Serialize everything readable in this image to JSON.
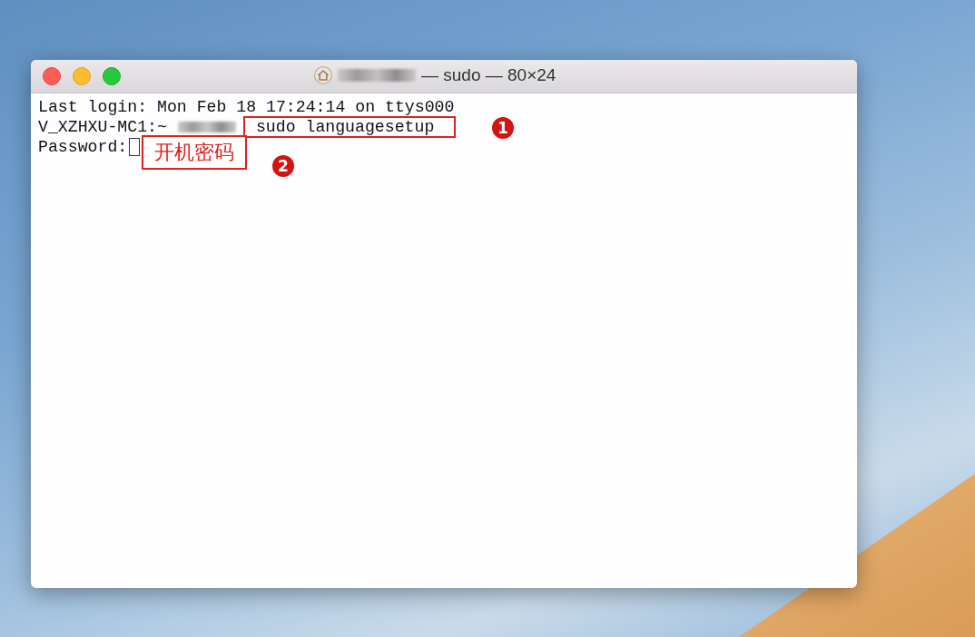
{
  "window": {
    "title": "— sudo — 80×24"
  },
  "terminal": {
    "lines": [
      {
        "kind": "output",
        "text": "Last login: Mon Feb 18 17:24:14 on ttys000"
      },
      {
        "kind": "command",
        "prompt": "V_XZHXU-MC1:~",
        "command": "sudo languagesetup",
        "badge": "1"
      },
      {
        "kind": "password",
        "prompt": "Password:",
        "note": "开机密码",
        "badge": "2"
      }
    ]
  }
}
